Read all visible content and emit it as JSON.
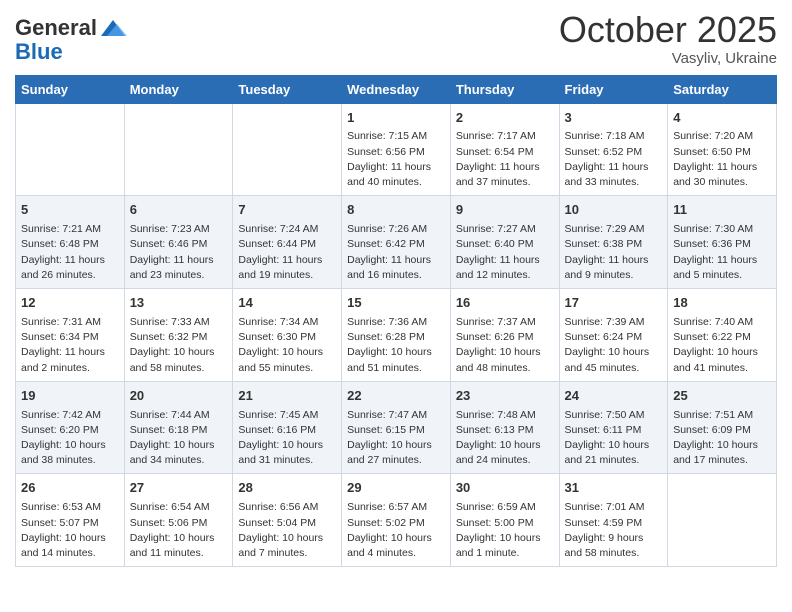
{
  "header": {
    "logo_general": "General",
    "logo_blue": "Blue",
    "month": "October 2025",
    "location": "Vasyliv, Ukraine"
  },
  "days_of_week": [
    "Sunday",
    "Monday",
    "Tuesday",
    "Wednesday",
    "Thursday",
    "Friday",
    "Saturday"
  ],
  "weeks": [
    [
      {
        "day": "",
        "sun": "",
        "mon": "",
        "detail": ""
      },
      {
        "day": "",
        "sun": "",
        "mon": "",
        "detail": ""
      },
      {
        "day": "",
        "sun": "",
        "mon": "",
        "detail": ""
      },
      {
        "day": "1",
        "sunrise": "7:15 AM",
        "sunset": "6:56 PM",
        "daylight": "11 hours and 40 minutes."
      },
      {
        "day": "2",
        "sunrise": "7:17 AM",
        "sunset": "6:54 PM",
        "daylight": "11 hours and 37 minutes."
      },
      {
        "day": "3",
        "sunrise": "7:18 AM",
        "sunset": "6:52 PM",
        "daylight": "11 hours and 33 minutes."
      },
      {
        "day": "4",
        "sunrise": "7:20 AM",
        "sunset": "6:50 PM",
        "daylight": "11 hours and 30 minutes."
      }
    ],
    [
      {
        "day": "5",
        "sunrise": "7:21 AM",
        "sunset": "6:48 PM",
        "daylight": "11 hours and 26 minutes."
      },
      {
        "day": "6",
        "sunrise": "7:23 AM",
        "sunset": "6:46 PM",
        "daylight": "11 hours and 23 minutes."
      },
      {
        "day": "7",
        "sunrise": "7:24 AM",
        "sunset": "6:44 PM",
        "daylight": "11 hours and 19 minutes."
      },
      {
        "day": "8",
        "sunrise": "7:26 AM",
        "sunset": "6:42 PM",
        "daylight": "11 hours and 16 minutes."
      },
      {
        "day": "9",
        "sunrise": "7:27 AM",
        "sunset": "6:40 PM",
        "daylight": "11 hours and 12 minutes."
      },
      {
        "day": "10",
        "sunrise": "7:29 AM",
        "sunset": "6:38 PM",
        "daylight": "11 hours and 9 minutes."
      },
      {
        "day": "11",
        "sunrise": "7:30 AM",
        "sunset": "6:36 PM",
        "daylight": "11 hours and 5 minutes."
      }
    ],
    [
      {
        "day": "12",
        "sunrise": "7:31 AM",
        "sunset": "6:34 PM",
        "daylight": "11 hours and 2 minutes."
      },
      {
        "day": "13",
        "sunrise": "7:33 AM",
        "sunset": "6:32 PM",
        "daylight": "10 hours and 58 minutes."
      },
      {
        "day": "14",
        "sunrise": "7:34 AM",
        "sunset": "6:30 PM",
        "daylight": "10 hours and 55 minutes."
      },
      {
        "day": "15",
        "sunrise": "7:36 AM",
        "sunset": "6:28 PM",
        "daylight": "10 hours and 51 minutes."
      },
      {
        "day": "16",
        "sunrise": "7:37 AM",
        "sunset": "6:26 PM",
        "daylight": "10 hours and 48 minutes."
      },
      {
        "day": "17",
        "sunrise": "7:39 AM",
        "sunset": "6:24 PM",
        "daylight": "10 hours and 45 minutes."
      },
      {
        "day": "18",
        "sunrise": "7:40 AM",
        "sunset": "6:22 PM",
        "daylight": "10 hours and 41 minutes."
      }
    ],
    [
      {
        "day": "19",
        "sunrise": "7:42 AM",
        "sunset": "6:20 PM",
        "daylight": "10 hours and 38 minutes."
      },
      {
        "day": "20",
        "sunrise": "7:44 AM",
        "sunset": "6:18 PM",
        "daylight": "10 hours and 34 minutes."
      },
      {
        "day": "21",
        "sunrise": "7:45 AM",
        "sunset": "6:16 PM",
        "daylight": "10 hours and 31 minutes."
      },
      {
        "day": "22",
        "sunrise": "7:47 AM",
        "sunset": "6:15 PM",
        "daylight": "10 hours and 27 minutes."
      },
      {
        "day": "23",
        "sunrise": "7:48 AM",
        "sunset": "6:13 PM",
        "daylight": "10 hours and 24 minutes."
      },
      {
        "day": "24",
        "sunrise": "7:50 AM",
        "sunset": "6:11 PM",
        "daylight": "10 hours and 21 minutes."
      },
      {
        "day": "25",
        "sunrise": "7:51 AM",
        "sunset": "6:09 PM",
        "daylight": "10 hours and 17 minutes."
      }
    ],
    [
      {
        "day": "26",
        "sunrise": "6:53 AM",
        "sunset": "5:07 PM",
        "daylight": "10 hours and 14 minutes."
      },
      {
        "day": "27",
        "sunrise": "6:54 AM",
        "sunset": "5:06 PM",
        "daylight": "10 hours and 11 minutes."
      },
      {
        "day": "28",
        "sunrise": "6:56 AM",
        "sunset": "5:04 PM",
        "daylight": "10 hours and 7 minutes."
      },
      {
        "day": "29",
        "sunrise": "6:57 AM",
        "sunset": "5:02 PM",
        "daylight": "10 hours and 4 minutes."
      },
      {
        "day": "30",
        "sunrise": "6:59 AM",
        "sunset": "5:00 PM",
        "daylight": "10 hours and 1 minute."
      },
      {
        "day": "31",
        "sunrise": "7:01 AM",
        "sunset": "4:59 PM",
        "daylight": "9 hours and 58 minutes."
      },
      {
        "day": "",
        "sunrise": "",
        "sunset": "",
        "daylight": ""
      }
    ]
  ]
}
